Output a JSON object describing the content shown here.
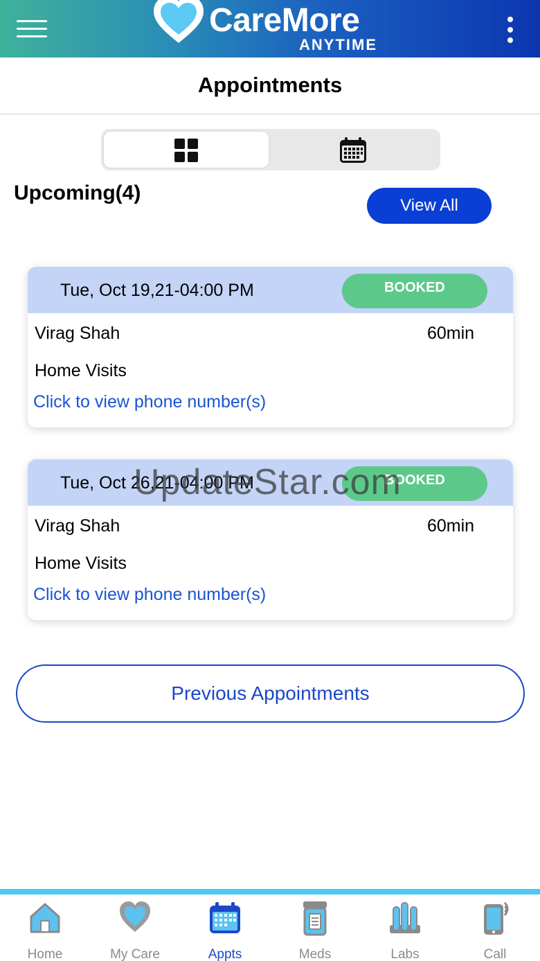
{
  "app": {
    "brand": "CareMore",
    "brand_sub": "ANYTIME",
    "page_title": "Appointments"
  },
  "view_toggle": {
    "options": [
      "grid-icon",
      "calendar-icon"
    ],
    "selected": "grid-icon"
  },
  "upcoming": {
    "title": "Upcoming(4)",
    "view_all_label": "View All"
  },
  "appointments": [
    {
      "datetime": "Tue, Oct 19,21-04:00 PM",
      "status": "BOOKED",
      "provider": "Virag Shah",
      "duration": "60min",
      "type": "Home Visits",
      "phone_link": "Click to view phone number(s)"
    },
    {
      "datetime": "Tue, Oct 26,21-04:00 PM",
      "status": "BOOKED",
      "provider": "Virag Shah",
      "duration": "60min",
      "type": "Home Visits",
      "phone_link": "Click to view phone number(s)"
    }
  ],
  "watermark": "UpdateStar.com",
  "previous_label": "Previous Appointments",
  "tabs": [
    {
      "label": "Home",
      "icon": "home-icon",
      "active": false
    },
    {
      "label": "My Care",
      "icon": "heart-icon",
      "active": false
    },
    {
      "label": "Appts",
      "icon": "calendar-icon",
      "active": true
    },
    {
      "label": "Meds",
      "icon": "pill-bottle-icon",
      "active": false
    },
    {
      "label": "Labs",
      "icon": "test-tubes-icon",
      "active": false
    },
    {
      "label": "Call",
      "icon": "phone-icon",
      "active": false
    }
  ],
  "colors": {
    "primary": "#0a3fd6",
    "booked": "#5cc98a",
    "card_header": "#c3d4f6",
    "link": "#1a55d0",
    "tab_accent": "#4fc7f2",
    "icon_fill": "#5aa9e6"
  }
}
